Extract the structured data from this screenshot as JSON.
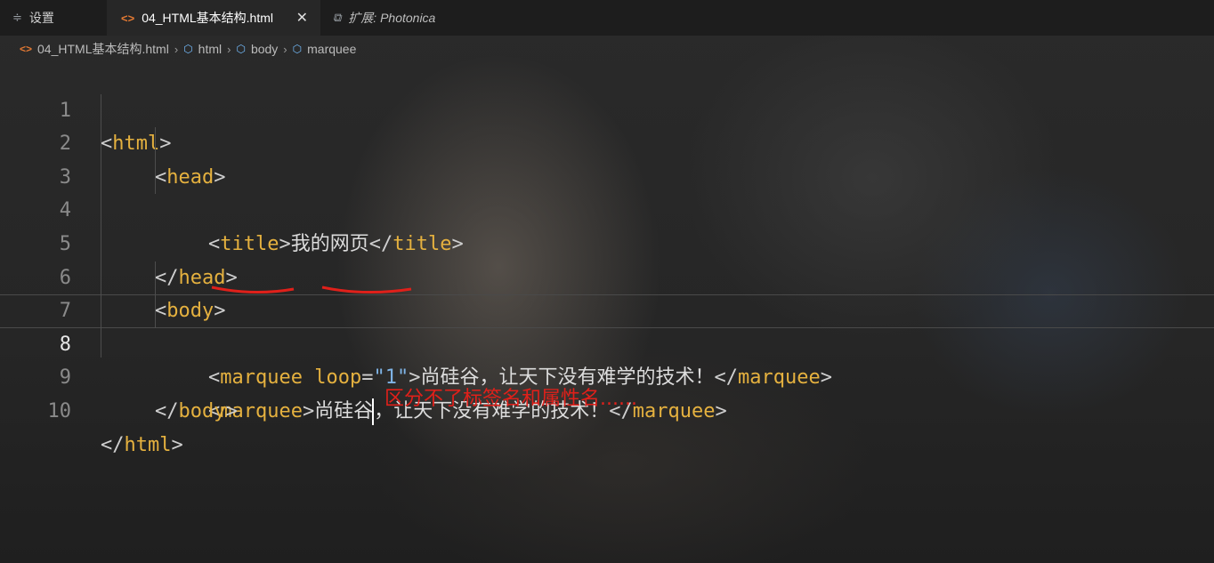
{
  "tabs": [
    {
      "label": "设置",
      "icon": "settings-icon"
    },
    {
      "label": "04_HTML基本结构.html",
      "icon": "html-file-icon",
      "active": true
    },
    {
      "label": "扩展: Photonica",
      "icon": "extension-icon"
    }
  ],
  "breadcrumb": [
    "04_HTML基本结构.html",
    "html",
    "body",
    "marquee"
  ],
  "lines": {
    "n1": "1",
    "n2": "2",
    "n3": "3",
    "n4": "4",
    "n5": "5",
    "n6": "6",
    "n7": "7",
    "n8": "8",
    "n9": "9",
    "n10": "10"
  },
  "code": {
    "html_tag": "html",
    "head_tag": "head",
    "title_tag": "title",
    "title_text": "我的网页",
    "body_tag": "body",
    "marquee_tag": "marquee",
    "loop_attr": "loop",
    "loop_value": "\"1\"",
    "marquee_text_1": "尚硅谷，让天下没有难学的技术！",
    "marquee_text_2a": "尚硅谷",
    "marquee_text_2b": "，让天下没有难学的技术！"
  },
  "annotation": "区分不了标签名和属性名......",
  "colors": {
    "tag": "#e5b13f",
    "string": "#7fb4e6",
    "annotation": "#e0201a",
    "file_icon": "#e37933",
    "symbol_icon": "#75beff"
  }
}
